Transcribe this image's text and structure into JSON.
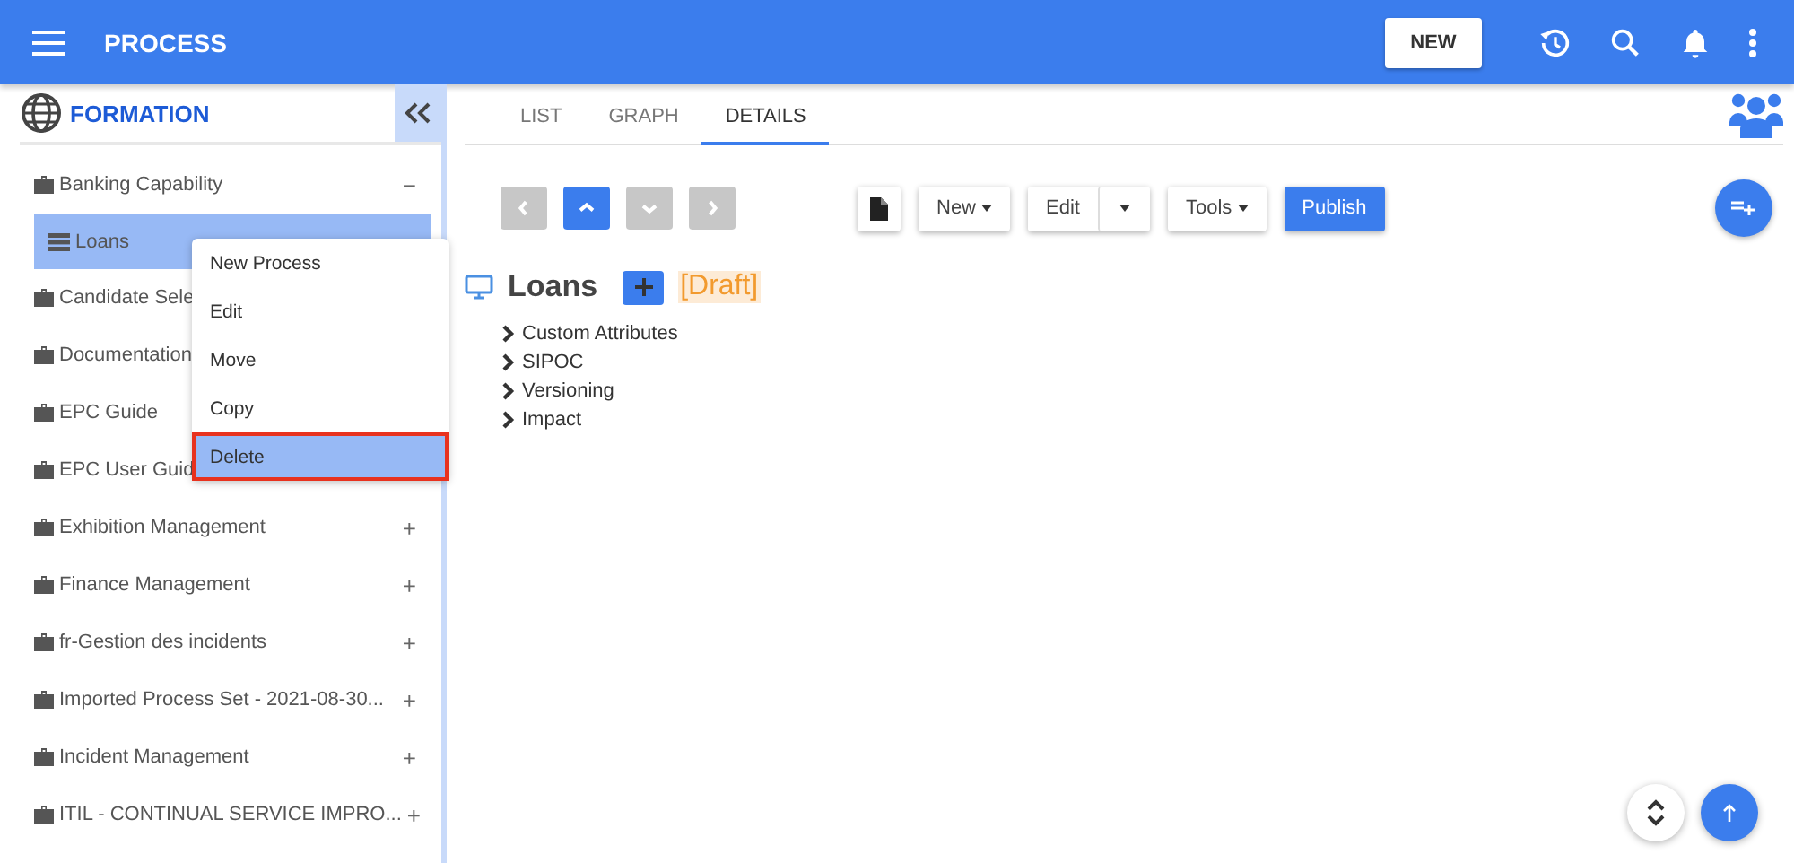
{
  "app_bar": {
    "title": "PROCESS",
    "new_button": "NEW"
  },
  "sidebar": {
    "title": "FORMATION",
    "items": [
      {
        "label": "Banking Capability",
        "expander": "−",
        "selected": false,
        "children": [
          {
            "label": "Loans",
            "selected": true
          }
        ]
      },
      {
        "label": "Candidate Sele",
        "selected": false
      },
      {
        "label": "Documentation",
        "selected": false
      },
      {
        "label": "EPC Guide",
        "selected": false
      },
      {
        "label": "EPC User Guid",
        "selected": false
      },
      {
        "label": "Exhibition Management",
        "expander": "+",
        "selected": false
      },
      {
        "label": "Finance Management",
        "expander": "+",
        "selected": false
      },
      {
        "label": "fr-Gestion des incidents",
        "expander": "+",
        "selected": false
      },
      {
        "label": "Imported Process Set - 2021-08-30...",
        "expander": "+",
        "selected": false
      },
      {
        "label": "Incident Management",
        "expander": "+",
        "selected": false
      },
      {
        "label": "ITIL - CONTINUAL SERVICE IMPRO...",
        "expander": "+",
        "selected": false
      }
    ]
  },
  "context_menu": {
    "items": [
      {
        "label": "New Process",
        "selected": false
      },
      {
        "label": "Edit",
        "selected": false
      },
      {
        "label": "Move",
        "selected": false
      },
      {
        "label": "Copy",
        "selected": false
      },
      {
        "label": "Delete",
        "selected": true
      }
    ]
  },
  "tabs": [
    {
      "label": "LIST",
      "selected": false
    },
    {
      "label": "GRAPH",
      "selected": false
    },
    {
      "label": "DETAILS",
      "selected": true
    }
  ],
  "nav_buttons": [
    {
      "kind": "previous",
      "enabled": false
    },
    {
      "kind": "up",
      "enabled": true
    },
    {
      "kind": "down",
      "enabled": false
    },
    {
      "kind": "next",
      "enabled": false
    }
  ],
  "toolbar": {
    "new": "New",
    "edit": "Edit",
    "tools": "Tools",
    "publish": "Publish"
  },
  "details": {
    "title": "Loans",
    "status": "[Draft]",
    "sections": [
      {
        "label": "Custom Attributes",
        "expanded": false
      },
      {
        "label": "SIPOC",
        "expanded": false
      },
      {
        "label": "Versioning",
        "expanded": false
      },
      {
        "label": "Impact",
        "expanded": false
      }
    ]
  }
}
